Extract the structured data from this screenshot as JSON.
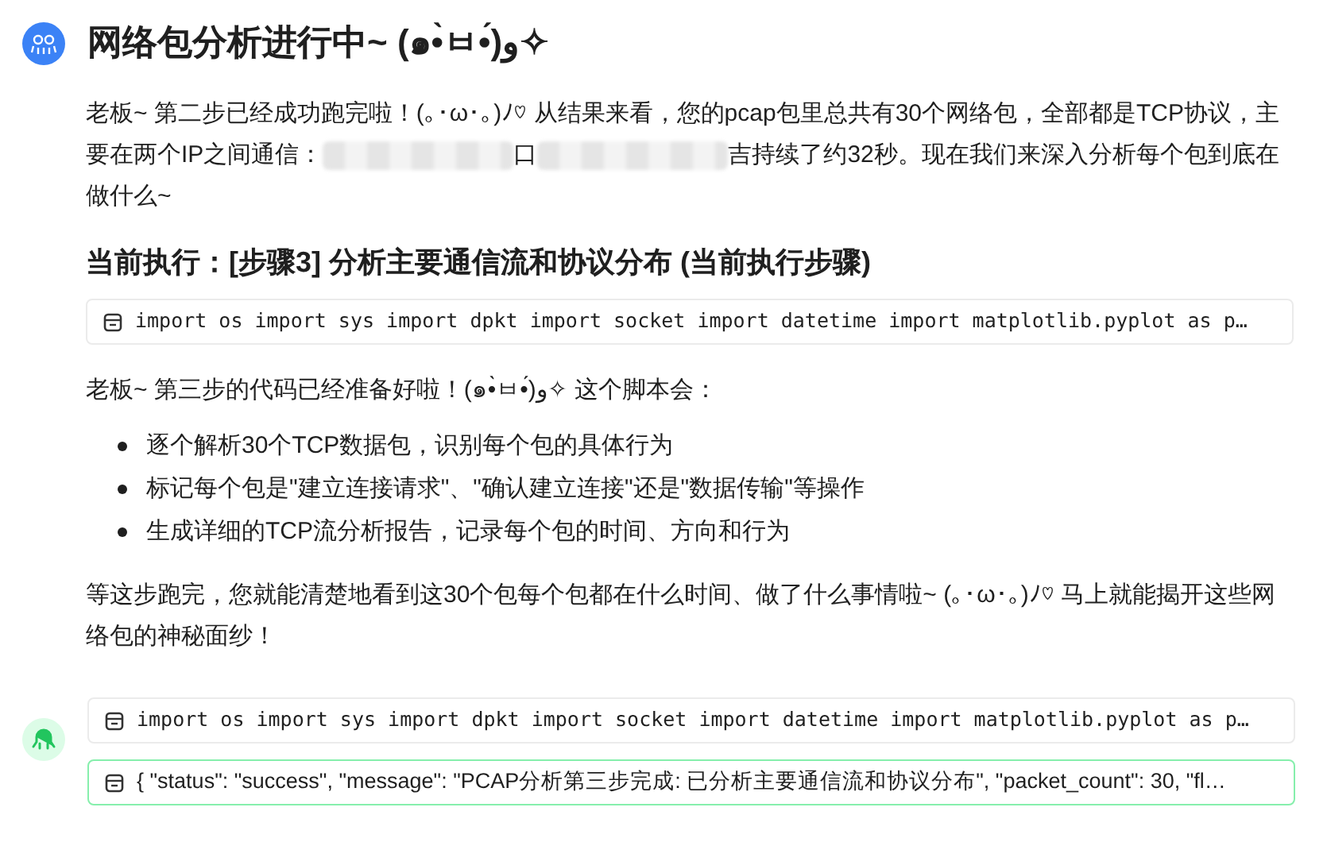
{
  "message": {
    "title": "网络包分析进行中~ (๑•̀ㅂ•́)و✧",
    "intro": [
      {
        "kind": "text",
        "text": "老板~ 第二步已经成功跑完啦！(｡･ω･｡)ﾉ♡ 从结果来看，您的pcap包里总共有30个网络包，全部都是TCP协议，主要在两个IP之间通信："
      },
      {
        "kind": "redacted"
      },
      {
        "kind": "text",
        "text": "口"
      },
      {
        "kind": "redacted"
      },
      {
        "kind": "text",
        "text": "吉持续了约32秒。现在我们来深入分析每个包到底在做什么~"
      }
    ],
    "heading": "当前执行：[步骤3] 分析主要通信流和协议分布 (当前执行步骤)",
    "code": "import os import sys import dpkt import socket import datetime import matplotlib.pyplot as p…",
    "lead": "老板~ 第三步的代码已经准备好啦！(๑•̀ㅂ•́)و✧ 这个脚本会：",
    "bullets": [
      "逐个解析30个TCP数据包，识别每个包的具体行为",
      "标记每个包是\"建立连接请求\"、\"确认建立连接\"还是\"数据传输\"等操作",
      "生成详细的TCP流分析报告，记录每个包的时间、方向和行为"
    ],
    "closing": "等这步跑完，您就能清楚地看到这30个包每个包都在什么时间、做了什么事情啦~ (｡･ω･｡)ﾉ♡ 马上就能揭开这些网络包的神秘面纱！"
  },
  "tool_calls": [
    {
      "kind": "code",
      "text": "import os import sys import dpkt import socket import datetime import matplotlib.pyplot as p…"
    },
    {
      "kind": "result",
      "text": "{ \"status\": \"success\", \"message\": \"PCAP分析第三步完成: 已分析主要通信流和协议分布\", \"packet_count\": 30, \"fl…"
    }
  ]
}
